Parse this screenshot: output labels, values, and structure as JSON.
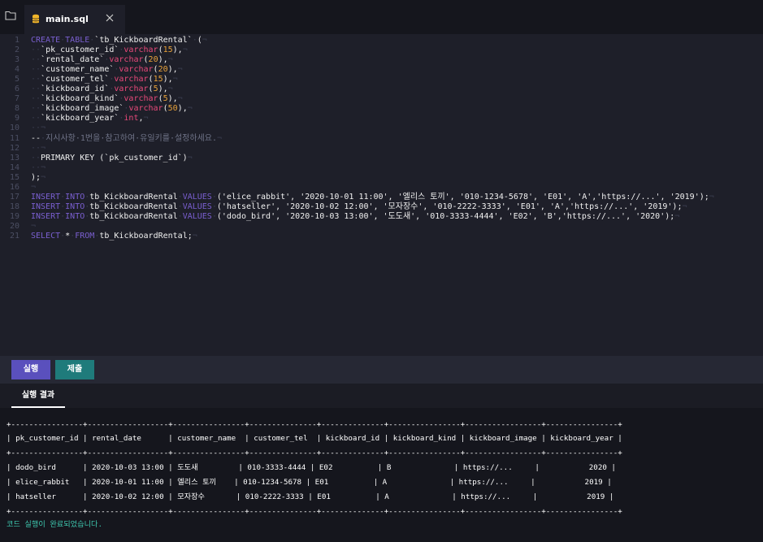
{
  "tab": {
    "filename": "main.sql"
  },
  "editor": {
    "lines": [
      {
        "n": "1",
        "parts": [
          [
            "kw",
            "CREATE"
          ],
          [
            "ws",
            "·"
          ],
          [
            "kw",
            "TABLE"
          ],
          [
            "ws",
            "·"
          ],
          [
            "tx",
            "`tb_KickboardRental`"
          ],
          [
            "ws",
            "·"
          ],
          [
            "tx",
            "("
          ],
          [
            "ws",
            "¬"
          ]
        ]
      },
      {
        "n": "2",
        "parts": [
          [
            "ws",
            "··"
          ],
          [
            "tx",
            "`pk_customer_id`"
          ],
          [
            "ws",
            "·"
          ],
          [
            "ty",
            "varchar"
          ],
          [
            "tx",
            "("
          ],
          [
            "num",
            "15"
          ],
          [
            "tx",
            "),"
          ],
          [
            "ws",
            "¬"
          ]
        ]
      },
      {
        "n": "3",
        "parts": [
          [
            "ws",
            "··"
          ],
          [
            "tx",
            "`rental_date`"
          ],
          [
            "ws",
            "·"
          ],
          [
            "ty",
            "varchar"
          ],
          [
            "tx",
            "("
          ],
          [
            "num",
            "20"
          ],
          [
            "tx",
            "),"
          ],
          [
            "ws",
            "¬"
          ]
        ]
      },
      {
        "n": "4",
        "parts": [
          [
            "ws",
            "··"
          ],
          [
            "tx",
            "`customer_name`"
          ],
          [
            "ws",
            "·"
          ],
          [
            "ty",
            "varchar"
          ],
          [
            "tx",
            "("
          ],
          [
            "num",
            "20"
          ],
          [
            "tx",
            "),"
          ],
          [
            "ws",
            "¬"
          ]
        ]
      },
      {
        "n": "5",
        "parts": [
          [
            "ws",
            "··"
          ],
          [
            "tx",
            "`customer_tel`"
          ],
          [
            "ws",
            "·"
          ],
          [
            "ty",
            "varchar"
          ],
          [
            "tx",
            "("
          ],
          [
            "num",
            "15"
          ],
          [
            "tx",
            "),"
          ],
          [
            "ws",
            "¬"
          ]
        ]
      },
      {
        "n": "6",
        "parts": [
          [
            "ws",
            "··"
          ],
          [
            "tx",
            "`kickboard_id`"
          ],
          [
            "ws",
            "·"
          ],
          [
            "ty",
            "varchar"
          ],
          [
            "tx",
            "("
          ],
          [
            "num",
            "5"
          ],
          [
            "tx",
            "),"
          ],
          [
            "ws",
            "¬"
          ]
        ]
      },
      {
        "n": "7",
        "parts": [
          [
            "ws",
            "··"
          ],
          [
            "tx",
            "`kickboard_kind`"
          ],
          [
            "ws",
            "·"
          ],
          [
            "ty",
            "varchar"
          ],
          [
            "tx",
            "("
          ],
          [
            "num",
            "5"
          ],
          [
            "tx",
            "),"
          ],
          [
            "ws",
            "¬"
          ]
        ]
      },
      {
        "n": "8",
        "parts": [
          [
            "ws",
            "··"
          ],
          [
            "tx",
            "`kickboard_image`"
          ],
          [
            "ws",
            "·"
          ],
          [
            "ty",
            "varchar"
          ],
          [
            "tx",
            "("
          ],
          [
            "num",
            "50"
          ],
          [
            "tx",
            "),"
          ],
          [
            "ws",
            "¬"
          ]
        ]
      },
      {
        "n": "9",
        "parts": [
          [
            "ws",
            "··"
          ],
          [
            "tx",
            "`kickboard_year`"
          ],
          [
            "ws",
            "·"
          ],
          [
            "ty",
            "int"
          ],
          [
            "tx",
            ","
          ],
          [
            "ws",
            "¬"
          ]
        ]
      },
      {
        "n": "10",
        "parts": [
          [
            "ws",
            "··¬"
          ]
        ]
      },
      {
        "n": "11",
        "parts": [
          [
            "tx",
            "--"
          ],
          [
            "ws",
            "·"
          ],
          [
            "cm",
            "지시사항·1번을·참고하여·유일키를·설정하세요."
          ],
          [
            "ws",
            "¬"
          ]
        ]
      },
      {
        "n": "12",
        "parts": [
          [
            "ws",
            "··¬"
          ]
        ]
      },
      {
        "n": "13",
        "parts": [
          [
            "ws",
            "··"
          ],
          [
            "tx",
            "PRIMARY KEY (`pk_customer_id`)"
          ],
          [
            "ws",
            "¬"
          ]
        ]
      },
      {
        "n": "14",
        "parts": [
          [
            "ws",
            "··¬"
          ]
        ]
      },
      {
        "n": "15",
        "parts": [
          [
            "tx",
            ");"
          ],
          [
            "ws",
            "¬"
          ]
        ]
      },
      {
        "n": "16",
        "parts": [
          [
            "ws",
            "¬"
          ]
        ]
      },
      {
        "n": "17",
        "parts": [
          [
            "kw",
            "INSERT"
          ],
          [
            "ws",
            "·"
          ],
          [
            "kw",
            "INTO"
          ],
          [
            "ws",
            "·"
          ],
          [
            "tx",
            "tb_KickboardRental"
          ],
          [
            "ws",
            "·"
          ],
          [
            "kw",
            "VALUES"
          ],
          [
            "ws",
            "·"
          ],
          [
            "tx",
            "('elice_rabbit', '2020-10-01 11:00', '엘리스 토끼', '010-1234-5678', 'E01', 'A','https://...', '2019');"
          ],
          [
            "ws",
            "¬"
          ]
        ]
      },
      {
        "n": "18",
        "parts": [
          [
            "kw",
            "INSERT"
          ],
          [
            "ws",
            "·"
          ],
          [
            "kw",
            "INTO"
          ],
          [
            "ws",
            "·"
          ],
          [
            "tx",
            "tb_KickboardRental"
          ],
          [
            "ws",
            "·"
          ],
          [
            "kw",
            "VALUES"
          ],
          [
            "ws",
            "·"
          ],
          [
            "tx",
            "('hatseller', '2020-10-02 12:00', '모자장수', '010-2222-3333', 'E01', 'A','https://...', '2019');"
          ],
          [
            "ws",
            "¬"
          ]
        ]
      },
      {
        "n": "19",
        "parts": [
          [
            "kw",
            "INSERT"
          ],
          [
            "ws",
            "·"
          ],
          [
            "kw",
            "INTO"
          ],
          [
            "ws",
            "·"
          ],
          [
            "tx",
            "tb_KickboardRental"
          ],
          [
            "ws",
            "·"
          ],
          [
            "kw",
            "VALUES"
          ],
          [
            "ws",
            "·"
          ],
          [
            "tx",
            "('dodo_bird', '2020-10-03 13:00', '도도새', '010-3333-4444', 'E02', 'B','https://...', '2020');"
          ],
          [
            "ws",
            "¬"
          ]
        ]
      },
      {
        "n": "20",
        "parts": [
          [
            "ws",
            "¬"
          ]
        ]
      },
      {
        "n": "21",
        "parts": [
          [
            "kw",
            "SELECT"
          ],
          [
            "ws",
            "·"
          ],
          [
            "tx",
            "*"
          ],
          [
            "ws",
            "·"
          ],
          [
            "kw",
            "FROM"
          ],
          [
            "ws",
            "·"
          ],
          [
            "tx",
            "tb_KickboardRental;"
          ],
          [
            "ws",
            "¬"
          ]
        ]
      }
    ]
  },
  "buttons": {
    "run": "실행",
    "submit": "제출"
  },
  "results": {
    "tab_label": "실행 결과",
    "lines": [
      "+----------------+------------------+----------------+---------------+--------------+----------------+-----------------+----------------+",
      "| pk_customer_id | rental_date      | customer_name  | customer_tel  | kickboard_id | kickboard_kind | kickboard_image | kickboard_year |",
      "+----------------+------------------+----------------+---------------+--------------+----------------+-----------------+----------------+",
      "| dodo_bird      | 2020-10-03 13:00 | 도도새         | 010-3333-4444 | E02          | B              | https://...     |           2020 |",
      "| elice_rabbit   | 2020-10-01 11:00 | 엘리스 토끼    | 010-1234-5678 | E01          | A              | https://...     |           2019 |",
      "| hatseller      | 2020-10-02 12:00 | 모자장수       | 010-2222-3333 | E01          | A              | https://...     |           2019 |",
      "+----------------+------------------+----------------+---------------+--------------+----------------+-----------------+----------------+"
    ],
    "status": "코드 실행이 완료되었습니다."
  },
  "colors": {
    "keyword": "#7a5fd0",
    "type": "#e8497a",
    "number": "#e8a23a",
    "run_button": "#5a50bd",
    "submit_button": "#1f7b7b",
    "status_text": "#3ec9b0"
  },
  "icons": {
    "folder": "folder-icon",
    "file": "database-file-icon",
    "close": "close-icon"
  }
}
